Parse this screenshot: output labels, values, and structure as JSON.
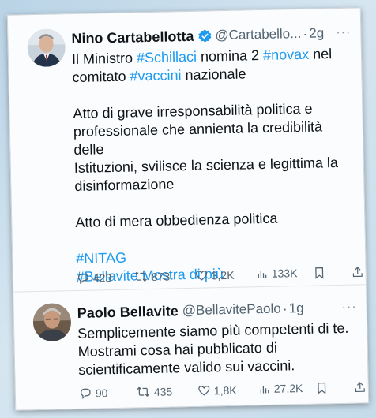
{
  "tweet1": {
    "name": "Nino Cartabellotta",
    "handle": "@Cartabello...",
    "separator": "·",
    "time": "2g",
    "more": "···",
    "line1_a": "Il Ministro ",
    "line1_tag1": "#Schillaci",
    "line1_b": " nomina 2 ",
    "line1_tag2": "#novax",
    "line1_c": " nel",
    "line2_a": "comitato ",
    "line2_tag": "#vaccini",
    "line2_b": " nazionale",
    "para2_l1": "Atto di grave irresponsabilità politica e",
    "para2_l2": "professionale che annienta la credibilità delle",
    "para2_l3": "Istituzioni, svilisce la scienza e legittima la",
    "para2_l4": "disinformazione",
    "para3": "Atto di mera obbedienza politica",
    "tag_nitag": "#NITAG",
    "tag_bellavite": "#Bellavite",
    "show_more": " Mostra di più",
    "replies": "423",
    "retweets": "873",
    "likes": "3,2K",
    "views": "133K"
  },
  "tweet2": {
    "name": "Paolo Bellavite",
    "handle": "@BellavitePaolo",
    "separator": "·",
    "time": "1g",
    "more": "···",
    "l1": "Semplicemente siamo più competenti di te.",
    "l2": "Mostrami cosa hai pubblicato di",
    "l3": "scientificamente valido sui vaccini.",
    "replies": "90",
    "retweets": "435",
    "likes": "1,8K",
    "views": "27,2K"
  },
  "colors": {
    "link": "#1d9bf0",
    "verified": "#1d9bf0",
    "muted": "#536471"
  }
}
